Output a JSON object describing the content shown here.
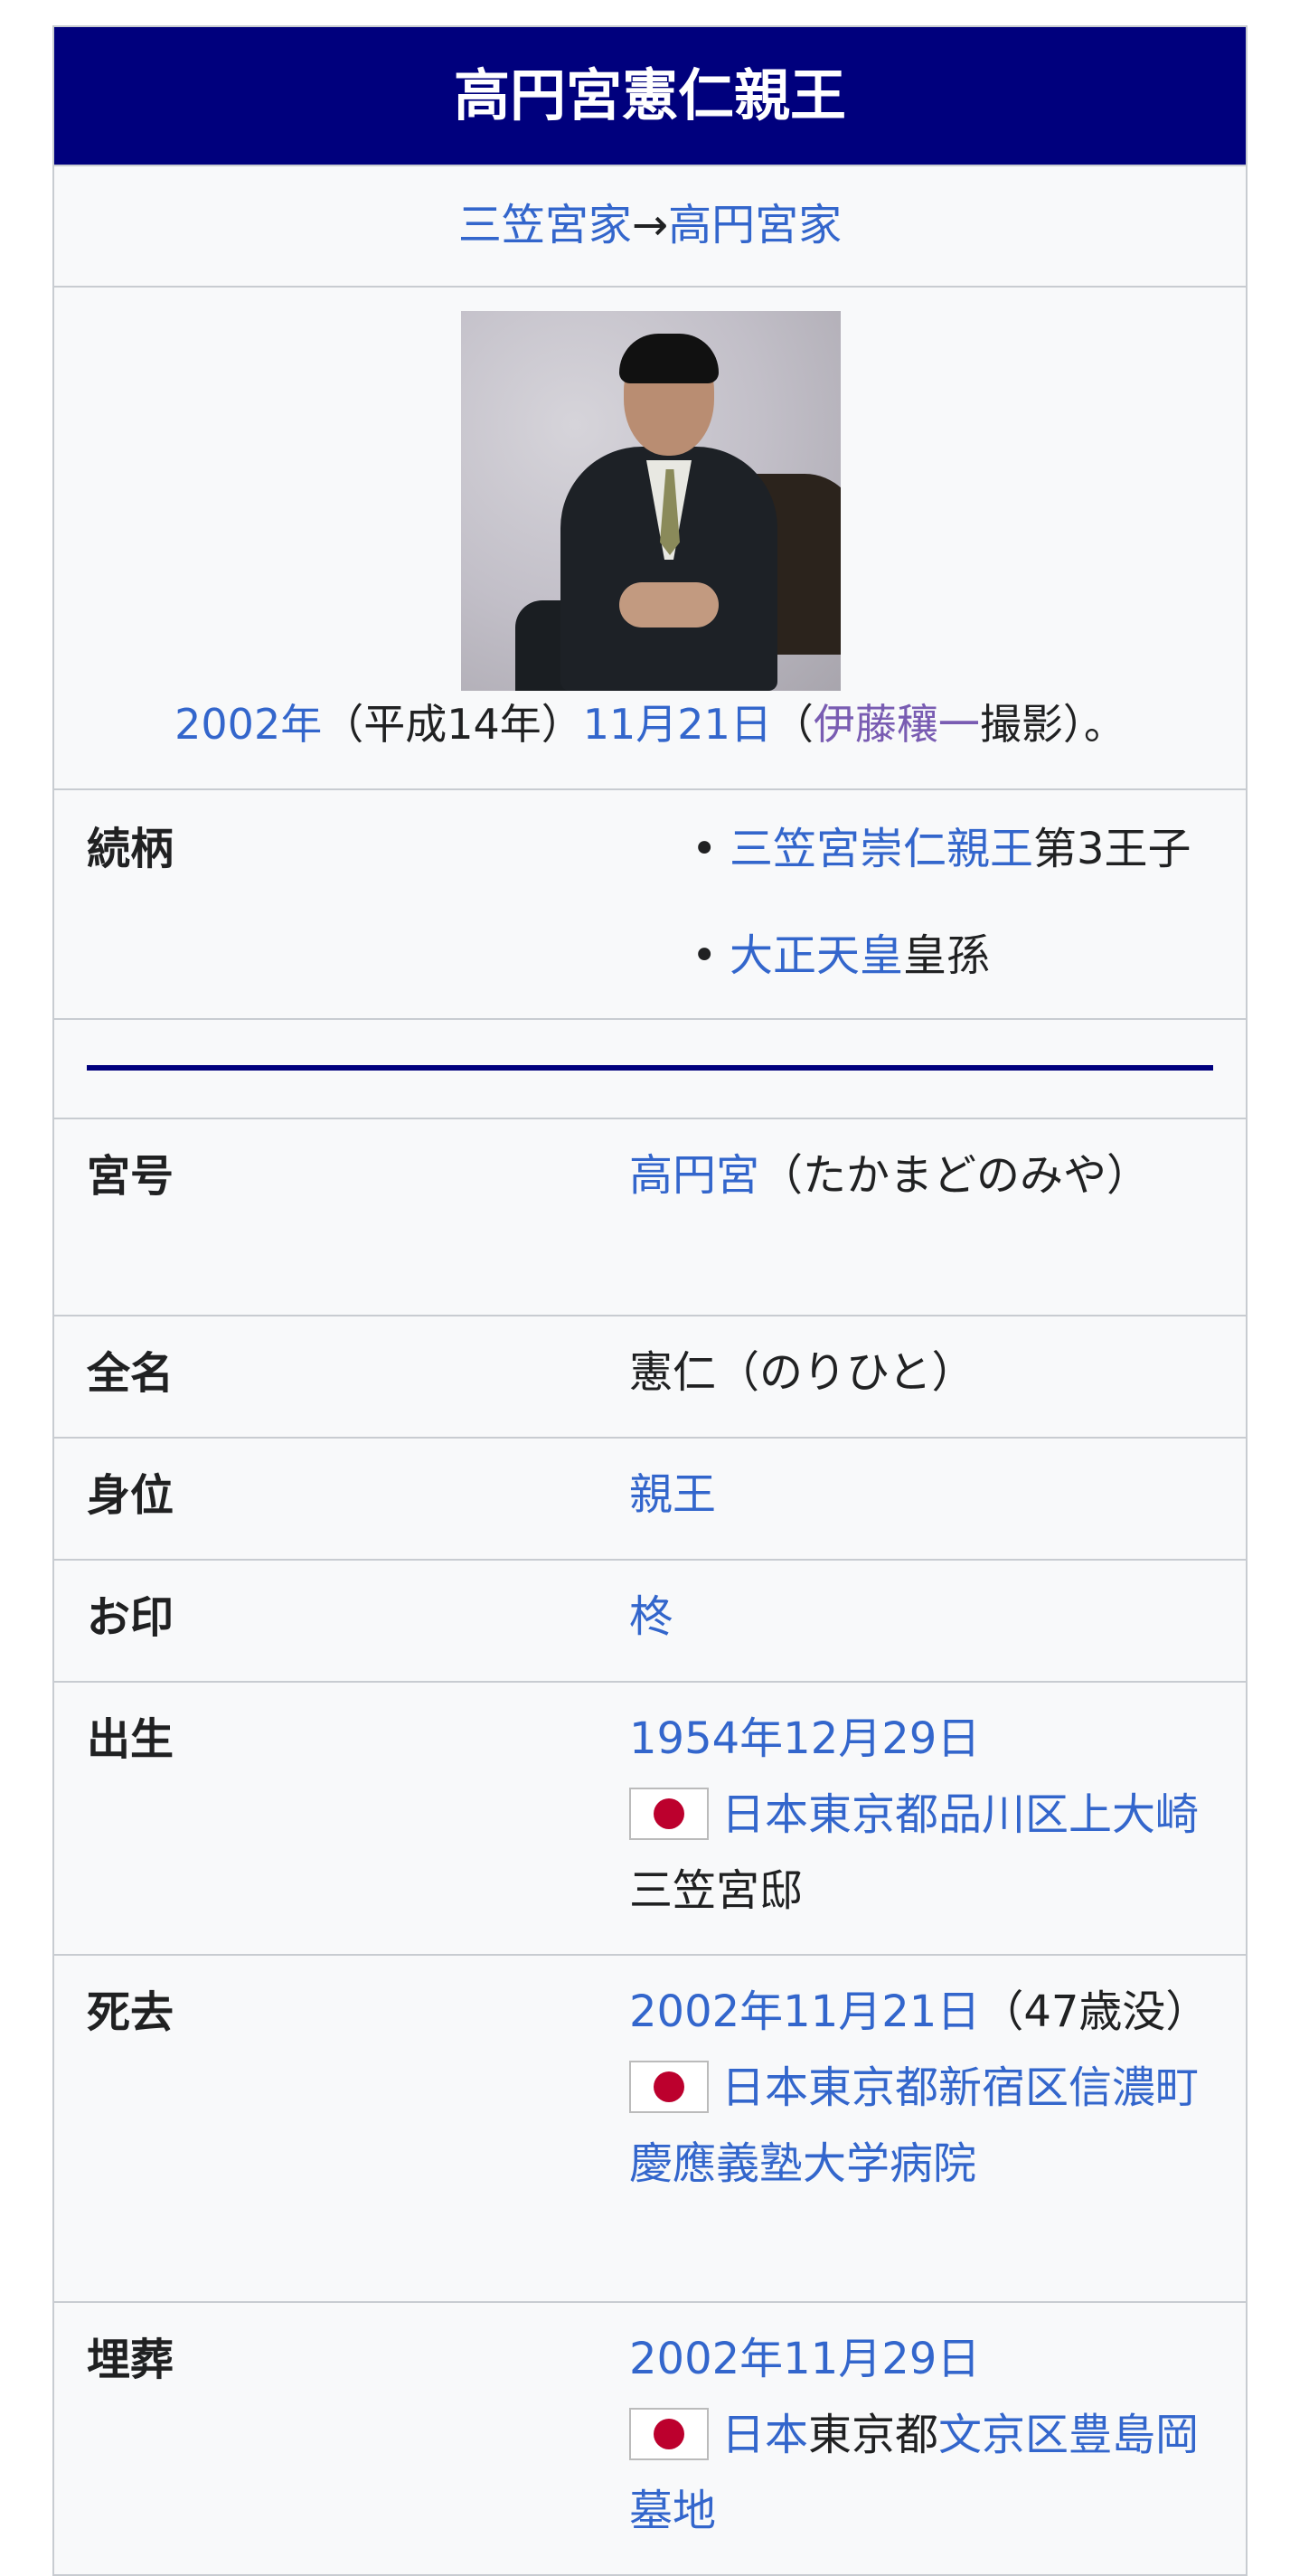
{
  "title": "高円宮憲仁親王",
  "house": {
    "from": "三笠宮家",
    "arrow": "→",
    "to": "高円宮家"
  },
  "photo": {
    "caption_year": "2002年",
    "caption_era": "（平成14年）",
    "caption_date": "11月21日",
    "caption_open": "（",
    "caption_photographer": "伊藤穰一",
    "caption_tail": "撮影）。"
  },
  "lineage": {
    "label": "続柄",
    "items": [
      {
        "link": "三笠宮崇仁親王",
        "text": "第3王子"
      },
      {
        "link": "大正天皇",
        "text": "皇孫"
      }
    ],
    "bullet": "•"
  },
  "rows": {
    "miyago": {
      "label": "宮号",
      "link": "高円宮",
      "text": "（たかまどのみや）"
    },
    "zenmei": {
      "label": "全名",
      "text": "憲仁（のりひと）"
    },
    "mii": {
      "label": "身位",
      "link": "親王"
    },
    "oshirushi": {
      "label": "お印",
      "link": "柊"
    },
    "birth": {
      "label": "出生",
      "date": "1954年12月29日",
      "place_link": "日本東京都品川区上大崎",
      "place_text": "三笠宮邸"
    },
    "death": {
      "label": "死去",
      "date": "2002年11月21日",
      "age": "（47歳没）",
      "place_link": "日本東京都新宿区信濃町慶應義塾大学病院"
    },
    "burial": {
      "label": "埋葬",
      "date": "2002年11月29日",
      "place_link1": "日本",
      "place_text": "東京都",
      "place_link2": "文京区豊島岡墓地"
    }
  },
  "colors": {
    "title_bg": "#00007d",
    "link": "#3366cc",
    "visited_link": "#795cb2",
    "flag_disc": "#bc002d"
  }
}
